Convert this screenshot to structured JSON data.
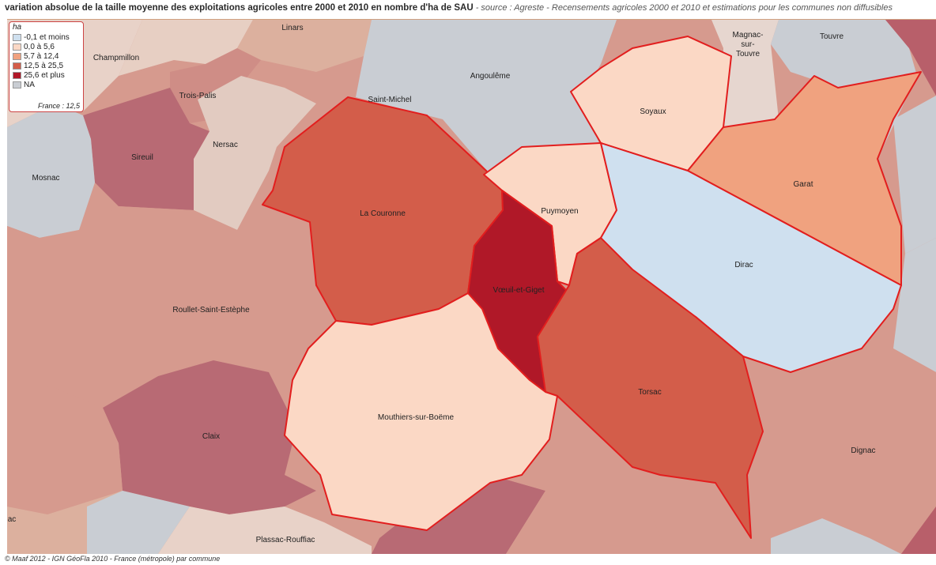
{
  "title": {
    "main": "variation absolue de la taille moyenne des exploitations agricoles entre 2000 et 2010 en nombre d'ha de SAU",
    "source": " - source : Agreste - Recensements agricoles 2000 et 2010 et estimations pour les communes non diffusibles"
  },
  "legend": {
    "unit": "ha",
    "classes": [
      {
        "label": "-0,1 et moins",
        "color": "#cfe0ef"
      },
      {
        "label": "0,0 à 5,6",
        "color": "#fbd8c5"
      },
      {
        "label": "5,7 à 12,4",
        "color": "#f0a27f"
      },
      {
        "label": "12,5 à 25,5",
        "color": "#d35d4a"
      },
      {
        "label": "25,6 et plus",
        "color": "#b01828"
      },
      {
        "label": "NA",
        "color": "#c9cdd3"
      }
    ],
    "france_note": "France : 12,5"
  },
  "map": {
    "communes": [
      "Linars",
      "Champmillon",
      "Trois-Palis",
      "Angoulême",
      "Saint-Michel",
      "Magnac-",
      "sur-",
      "Touvre",
      "Touvre",
      "Soyaux",
      "Garat",
      "Nersac",
      "Sireuil",
      "Mosnac",
      "La Couronne",
      "Puymoyen",
      "Dirac",
      "Vœuil-et-Giget",
      "Roullet-Saint-Estèphe",
      "Torsac",
      "Mouthiers-sur-Boëme",
      "Claix",
      "Dignac",
      "ac",
      "Plassac-Rouffiac"
    ]
  },
  "footer": "© Maaf 2012 - IGN GéoFla 2010 - France (métropole) par commune"
}
